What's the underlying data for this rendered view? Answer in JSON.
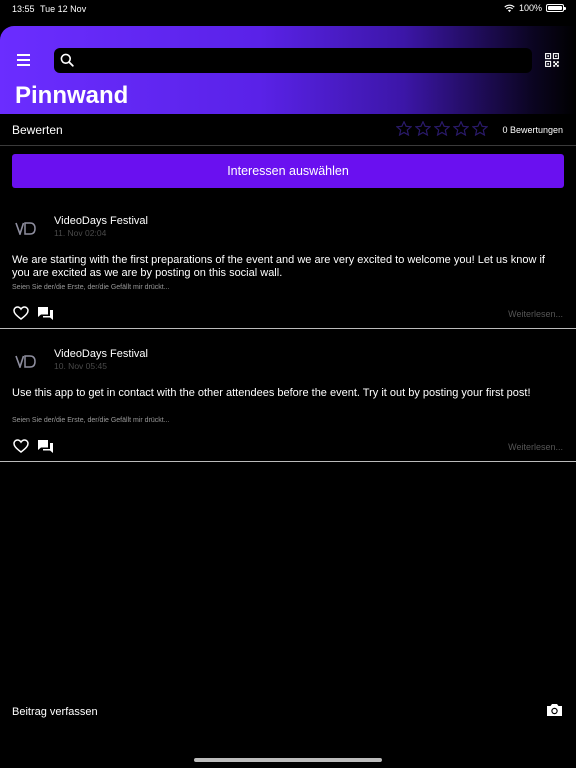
{
  "status": {
    "time": "13:55",
    "date": "Tue 12 Nov",
    "battery": "100%",
    "battery_level": 1.0
  },
  "header": {
    "title": "Pinnwand",
    "search_placeholder": ""
  },
  "rating": {
    "label": "Bewerten",
    "stars": 0,
    "max_stars": 5,
    "count_text": "0 Bewertungen"
  },
  "interests": {
    "button_label": "Interessen auswählen"
  },
  "posts": [
    {
      "author": "VideoDays Festival",
      "time": "11. Nov 02:04",
      "text": "We are starting with the first preparations of the event and we are very excited to welcome you! Let us know if you are excited as we are by posting on this social wall.",
      "likes_info": "Seien Sie der/die Erste, der/die Gefällt mir drückt...",
      "read_more": "Weiterlesen..."
    },
    {
      "author": "VideoDays Festival",
      "time": "10. Nov 05:45",
      "text": "Use this app to get in contact with the other attendees before the event. Try it out by posting your first post!",
      "likes_info": "Seien Sie der/die Erste, der/die Gefällt mir drückt...",
      "read_more": "Weiterlesen..."
    }
  ],
  "footer": {
    "compose_label": "Beitrag verfassen"
  },
  "colors": {
    "accent": "#6a10f0",
    "header_gradient_start": "#6b2dff",
    "star_empty": "#2a1a6a"
  },
  "icons": {
    "menu": "hamburger-icon",
    "search": "search-icon",
    "qr": "qr-code-icon",
    "like": "heart-icon",
    "comment": "chat-bubbles-icon",
    "camera": "camera-icon",
    "wifi": "wifi-icon",
    "battery": "battery-icon"
  }
}
